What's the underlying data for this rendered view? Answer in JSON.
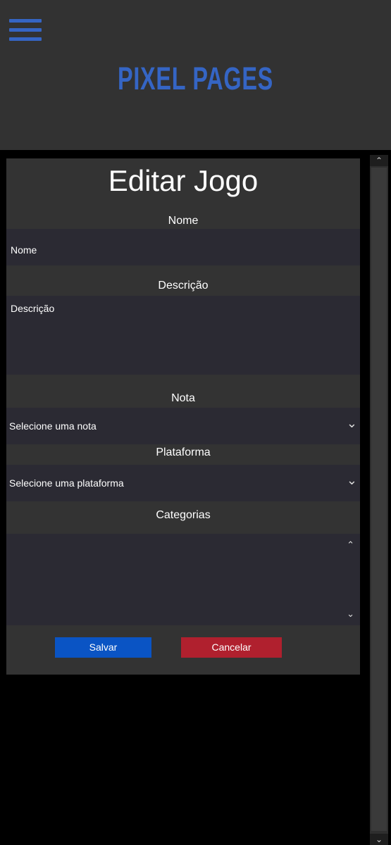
{
  "header": {
    "brand": "PIXEL PAGES",
    "menu_icon": "hamburger-menu-icon"
  },
  "form": {
    "title": "Editar Jogo",
    "nome": {
      "label": "Nome",
      "placeholder": "Nome"
    },
    "descricao": {
      "label": "Descrição",
      "placeholder": "Descrição"
    },
    "nota": {
      "label": "Nota",
      "selected": "Selecione uma nota"
    },
    "plataforma": {
      "label": "Plataforma",
      "selected": "Selecione uma plataforma"
    },
    "categorias": {
      "label": "Categorias"
    },
    "save_label": "Salvar",
    "cancel_label": "Cancelar"
  },
  "colors": {
    "brand": "#3565c4",
    "save": "#0a54c4",
    "cancel": "#b0202e",
    "panel": "#333333",
    "field": "#2b2a33"
  }
}
